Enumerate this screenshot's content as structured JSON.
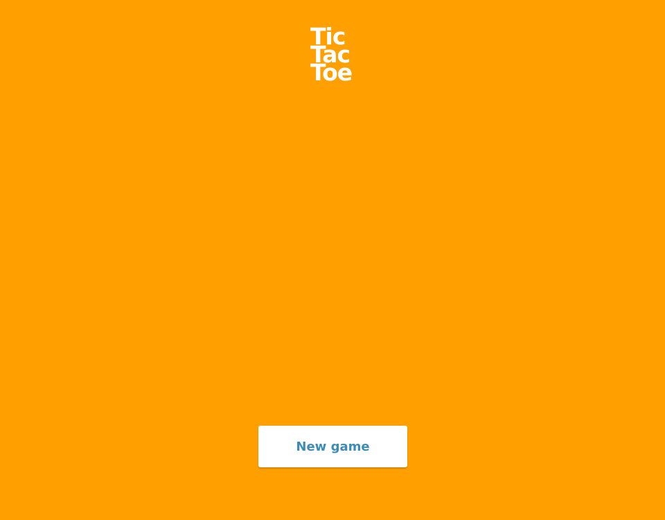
{
  "logo": {
    "line1": "Tic",
    "line2": "Tac",
    "line3": "Toe"
  },
  "controls": {
    "new_game_label": "New game"
  },
  "colors": {
    "background": "#ffa000",
    "logo_text": "#ffffff",
    "button_background": "#ffffff",
    "button_text": "#3d8cb8"
  }
}
